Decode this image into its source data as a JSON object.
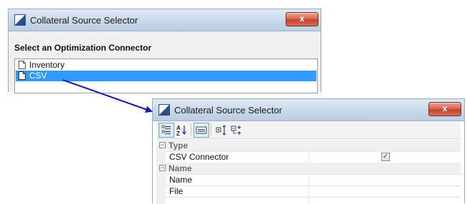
{
  "window1": {
    "title": "Collateral Source Selector",
    "close_label": "x",
    "header": "Select an Optimization Connector",
    "items": [
      {
        "label": "Inventory",
        "selected": false
      },
      {
        "label": "CSV",
        "selected": true
      }
    ]
  },
  "window2": {
    "title": "Collateral Source Selector",
    "close_label": "x",
    "toolbar": [
      "categorized-icon",
      "alphabetical-icon",
      "property-pages-icon",
      "expand-all-icon",
      "collapse-all-icon"
    ],
    "grid": {
      "categories": [
        {
          "label": "Type",
          "expander": "⊟",
          "properties": [
            {
              "name": "CSV Connector",
              "value": "✓"
            }
          ]
        },
        {
          "label": "Name",
          "expander": "⊟",
          "properties": [
            {
              "name": "Name",
              "value": ""
            },
            {
              "name": "File",
              "value": ""
            }
          ]
        }
      ]
    }
  },
  "colors": {
    "selection": "#3399ff",
    "arrow": "#1a1aa8",
    "close": "#c2432b"
  }
}
